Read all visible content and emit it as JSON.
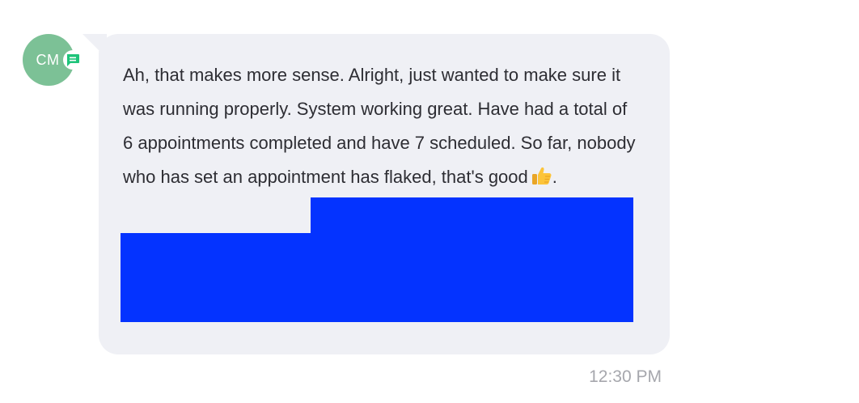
{
  "sender": {
    "initials": "CM",
    "avatar_color": "#7cc196",
    "badge_icon": "chat-bubble-icon",
    "badge_color": "#1fc47a"
  },
  "message": {
    "text": "Ah, that makes more sense. Alright, just wanted to make sure it was running properly. System working great. Have had a total of 6 appointments completed and have 7 scheduled. So far, nobody who has set an appointment has flaked, that's good",
    "trailing_emoji_icon": "thumbs-up-icon",
    "trailing_text": ".",
    "bubble_color": "#eff0f5",
    "redaction_color": "#0433ff",
    "time": "12:30 PM"
  }
}
